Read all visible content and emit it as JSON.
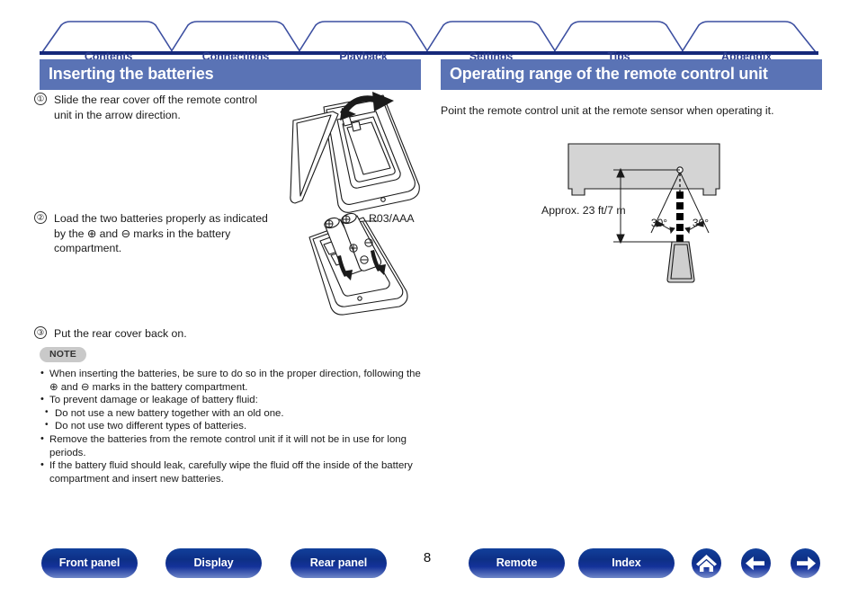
{
  "tabs": [
    {
      "label": "Contents",
      "name": "tab-contents"
    },
    {
      "label": "Connections",
      "name": "tab-connections"
    },
    {
      "label": "Playback",
      "name": "tab-playback"
    },
    {
      "label": "Settings",
      "name": "tab-settings"
    },
    {
      "label": "Tips",
      "name": "tab-tips"
    },
    {
      "label": "Appendix",
      "name": "tab-appendix"
    }
  ],
  "left": {
    "heading": "Inserting the batteries",
    "steps": [
      {
        "num": "①",
        "text": "Slide the rear cover off the remote control unit in the arrow direction."
      },
      {
        "num": "②",
        "text": "Load the two batteries properly as indicated by the ⊕ and ⊖ marks in the battery compartment."
      },
      {
        "num": "③",
        "text": "Put the rear cover back on."
      }
    ],
    "figure_label": "R03/AAA",
    "note": {
      "badge": "NOTE",
      "items": [
        "When inserting the batteries, be sure to do so in the proper direction, following the ⊕ and ⊖ marks in the battery compartment.",
        "To prevent damage or leakage of battery fluid:",
        "Remove the batteries from the remote control unit if it will not be in use for long periods.",
        "If the battery fluid should leak, carefully wipe the fluid off the inside of the battery compartment and insert new batteries."
      ],
      "subitems": [
        "Do not use a new battery together with an old one.",
        "Do not use two different types of batteries."
      ]
    }
  },
  "right": {
    "heading": "Operating range of the remote control unit",
    "lead": "Point the remote control unit at the remote sensor when operating it.",
    "diagram": {
      "distance_label": "Approx. 23 ft/7 m",
      "angle_left": "30°",
      "angle_right": "30°"
    }
  },
  "footer": {
    "buttons": [
      {
        "label": "Front panel",
        "name": "footer-front-panel"
      },
      {
        "label": "Display",
        "name": "footer-display"
      },
      {
        "label": "Rear panel",
        "name": "footer-rear-panel"
      },
      {
        "label": "Remote",
        "name": "footer-remote"
      },
      {
        "label": "Index",
        "name": "footer-index"
      }
    ],
    "icons": [
      {
        "name": "home-icon"
      },
      {
        "name": "arrow-left-icon"
      },
      {
        "name": "arrow-right-icon"
      }
    ],
    "page_number": "8"
  },
  "colors": {
    "heading_bar": "#5a73b5",
    "tab_text": "#2d3f8f",
    "tab_border": "#3b4ea0",
    "rule": "#16297a",
    "pill": "#0d2f86",
    "note_badge": "#c9c9c9"
  }
}
